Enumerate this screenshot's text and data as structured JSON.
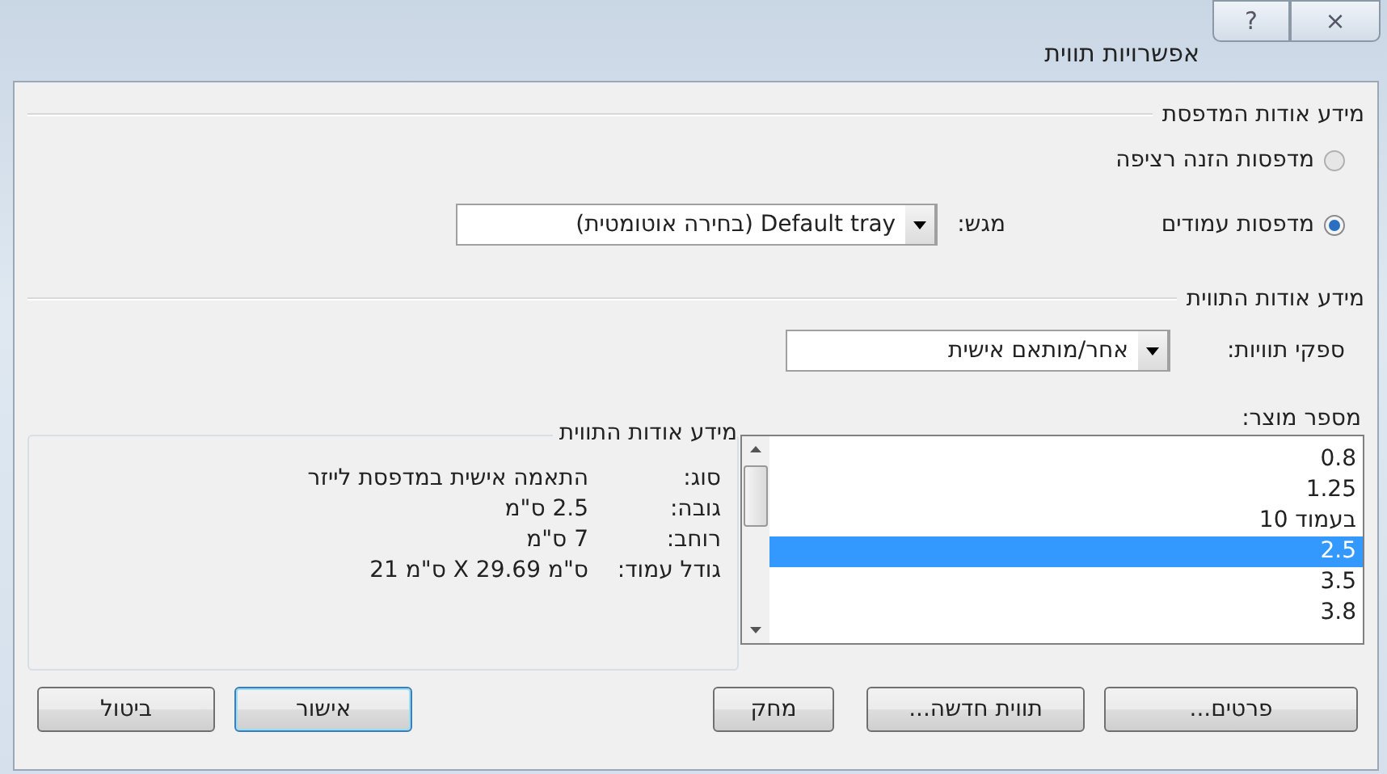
{
  "window": {
    "title": "אפשרויות תווית",
    "controls": [
      "×",
      "?"
    ]
  },
  "printer_info": {
    "heading": "מידע אודות המדפסת",
    "options": [
      {
        "label": "מדפסות הזנה רציפה",
        "selected": false
      },
      {
        "label": "מדפסות עמודים",
        "selected": true
      }
    ],
    "tray": {
      "label": "מגש:",
      "value": "Default tray (בחירה אוטומטית)"
    }
  },
  "label_info": {
    "heading": "מידע אודות התווית",
    "vendor": {
      "label": "ספקי תוויות:",
      "value": "אחר/מותאם אישית"
    },
    "product_number": {
      "label": "מספר מוצר:",
      "items": [
        {
          "text": "0.8",
          "selected": false
        },
        {
          "text": "1.25",
          "selected": false
        },
        {
          "text": "10 בעמוד",
          "selected": false
        },
        {
          "text": "2.5",
          "selected": true
        },
        {
          "text": "3.5",
          "selected": false
        },
        {
          "text": "3.8",
          "selected": false
        }
      ]
    }
  },
  "details": {
    "title": "מידע אודות התווית",
    "rows": [
      {
        "label": "סוג:",
        "value": "התאמה אישית במדפסת לייזר"
      },
      {
        "label": "גובה:",
        "value": "2.5 ס\"מ"
      },
      {
        "label": "רוחב:",
        "value": "7 ס\"מ"
      },
      {
        "label": "גודל עמוד:",
        "value": "ס\"מ 29.69 X ס\"מ 21"
      }
    ]
  },
  "buttons": [
    {
      "label": "פרטים...",
      "default": false
    },
    {
      "label": "תווית חדשה...",
      "default": false
    },
    {
      "label": "מחק",
      "default": false
    },
    {
      "label": "אישור",
      "default": true
    },
    {
      "label": "ביטול",
      "default": false
    }
  ]
}
